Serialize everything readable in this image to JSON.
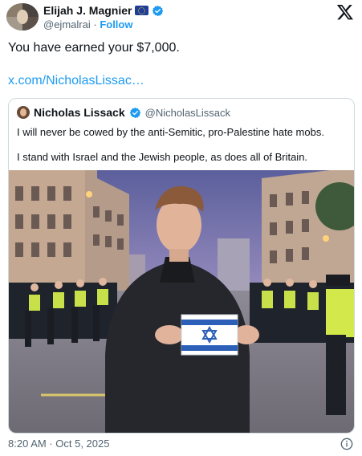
{
  "author": {
    "name": "Elijah J. Magnier",
    "handle": "@ejmalrai",
    "separator": "·",
    "follow_label": "Follow"
  },
  "tweet": {
    "text": "You have earned your $7,000.",
    "link": "x.com/NicholasLissac…"
  },
  "quoted": {
    "name": "Nicholas Lissack",
    "handle": "@NicholasLissack",
    "line1": "I will never be cowed by the anti-Semitic, pro-Palestine hate mobs.",
    "line2": "I stand with Israel and the Jewish people, as does all of Britain."
  },
  "footer": {
    "timestamp": "8:20 AM · Oct 5, 2025"
  },
  "icons": {
    "platform": "x-logo-icon",
    "verified": "verified-badge-icon",
    "flag": "eu-flag-icon",
    "info": "info-icon"
  },
  "colors": {
    "link": "#1d9bf0",
    "secondary_text": "#536471",
    "verified": "#1d9bf0",
    "border": "#cfd9de"
  }
}
